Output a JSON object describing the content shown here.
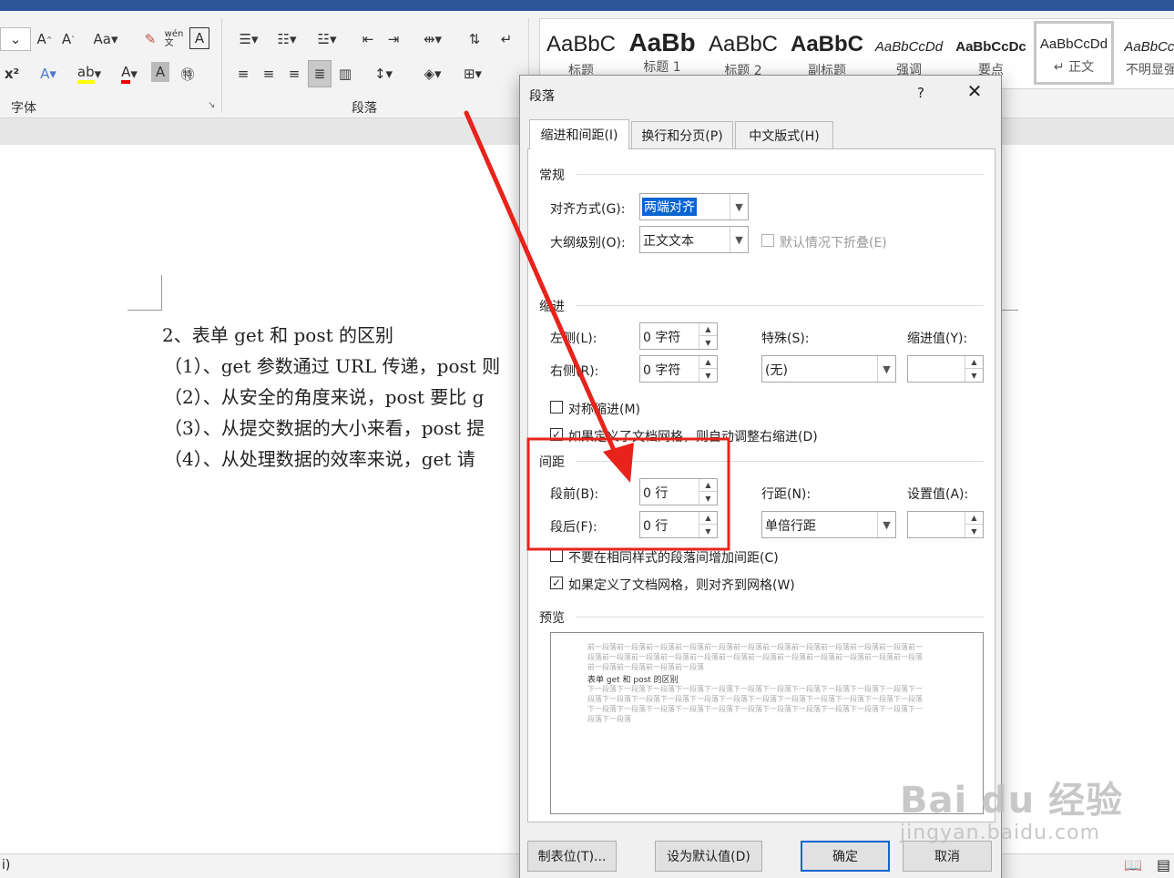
{
  "ribbon": {
    "font_group_label": "字体",
    "paragraph_group_label": "段落",
    "styles": [
      {
        "sample": "AaBbC",
        "name": "标题"
      },
      {
        "sample": "AaBb",
        "name": "标题 1"
      },
      {
        "sample": "AaBbC",
        "name": "标题 2"
      },
      {
        "sample": "AaBbC",
        "name": "副标题"
      },
      {
        "sample": "AaBbCcDd",
        "name": "强调"
      },
      {
        "sample": "AaBbCcDc",
        "name": "要点"
      },
      {
        "sample": "AaBbCcDd",
        "name": "↵ 正文"
      },
      {
        "sample": "AaBbCcI",
        "name": "不明显强"
      }
    ]
  },
  "document": {
    "lines": [
      "2、表单 get 和 post 的区别",
      "（1）、get 参数通过 URL 传递，post 则",
      "（2）、从安全的角度来说，post 要比 g",
      "（3）、从提交数据的大小来看，post 提",
      "（4）、从处理数据的效率来说，get 请"
    ]
  },
  "dialog": {
    "title": "段落",
    "help": "?",
    "close": "✕",
    "tabs": [
      "缩进和间距(I)",
      "换行和分页(P)",
      "中文版式(H)"
    ],
    "general": {
      "section": "常规",
      "alignment_label": "对齐方式(G):",
      "alignment_value": "两端对齐",
      "outline_label": "大纲级别(O):",
      "outline_value": "正文文本",
      "collapse_label": "默认情况下折叠(E)"
    },
    "indent": {
      "section": "缩进",
      "left_label": "左侧(L):",
      "left_value": "0 字符",
      "right_label": "右侧(R):",
      "right_value": "0 字符",
      "special_label": "特殊(S):",
      "special_value": "(无)",
      "by_label": "缩进值(Y):",
      "by_value": "",
      "mirror_label": "对称缩进(M)",
      "auto_adjust_label": "如果定义了文档网格，则自动调整右缩进(D)"
    },
    "spacing": {
      "section": "间距",
      "before_label": "段前(B):",
      "before_value": "0 行",
      "after_label": "段后(F):",
      "after_value": "0 行",
      "line_label": "行距(N):",
      "line_value": "单倍行距",
      "at_label": "设置值(A):",
      "at_value": "",
      "no_space_label": "不要在相同样式的段落间增加间距(C)",
      "snap_grid_label": "如果定义了文档网格，则对齐到网格(W)"
    },
    "preview": {
      "section": "预览",
      "prev_text": "前一段落前一段落前一段落前一段落前一段落前一段落前一段落前一段落前一段落前一段落前一段落前一段落前一段落前一段落前一段落前一段落前一段落前一段落前一段落前一段落前一段落前一段落前一段落前一段落前一段落前一段落前一段落",
      "main_text": "表单 get 和 post 的区别",
      "next_text": "下一段落下一段落下一段落下一段落下一段落下一段落下一段落下一段落下一段落下一段落下一段落下一段落下一段落下一段落下一段落下一段落下一段落下一段落下一段落下一段落下一段落下一段落下一段落下一段落下一段落下一段落下一段落下一段落下一段落下一段落下一段落下一段落下一段落下一段落下一段落下一段落"
    },
    "buttons": {
      "tabs": "制表位(T)...",
      "set_default": "设为默认值(D)",
      "ok": "确定",
      "cancel": "取消"
    }
  },
  "statusbar": {
    "left_text": "i)",
    "read_mode_icon": "book-icon"
  },
  "annotation": {
    "color": "#e8231b"
  },
  "watermark": {
    "main": "Bai du 经验",
    "sub": "jingyan.baidu.com"
  }
}
